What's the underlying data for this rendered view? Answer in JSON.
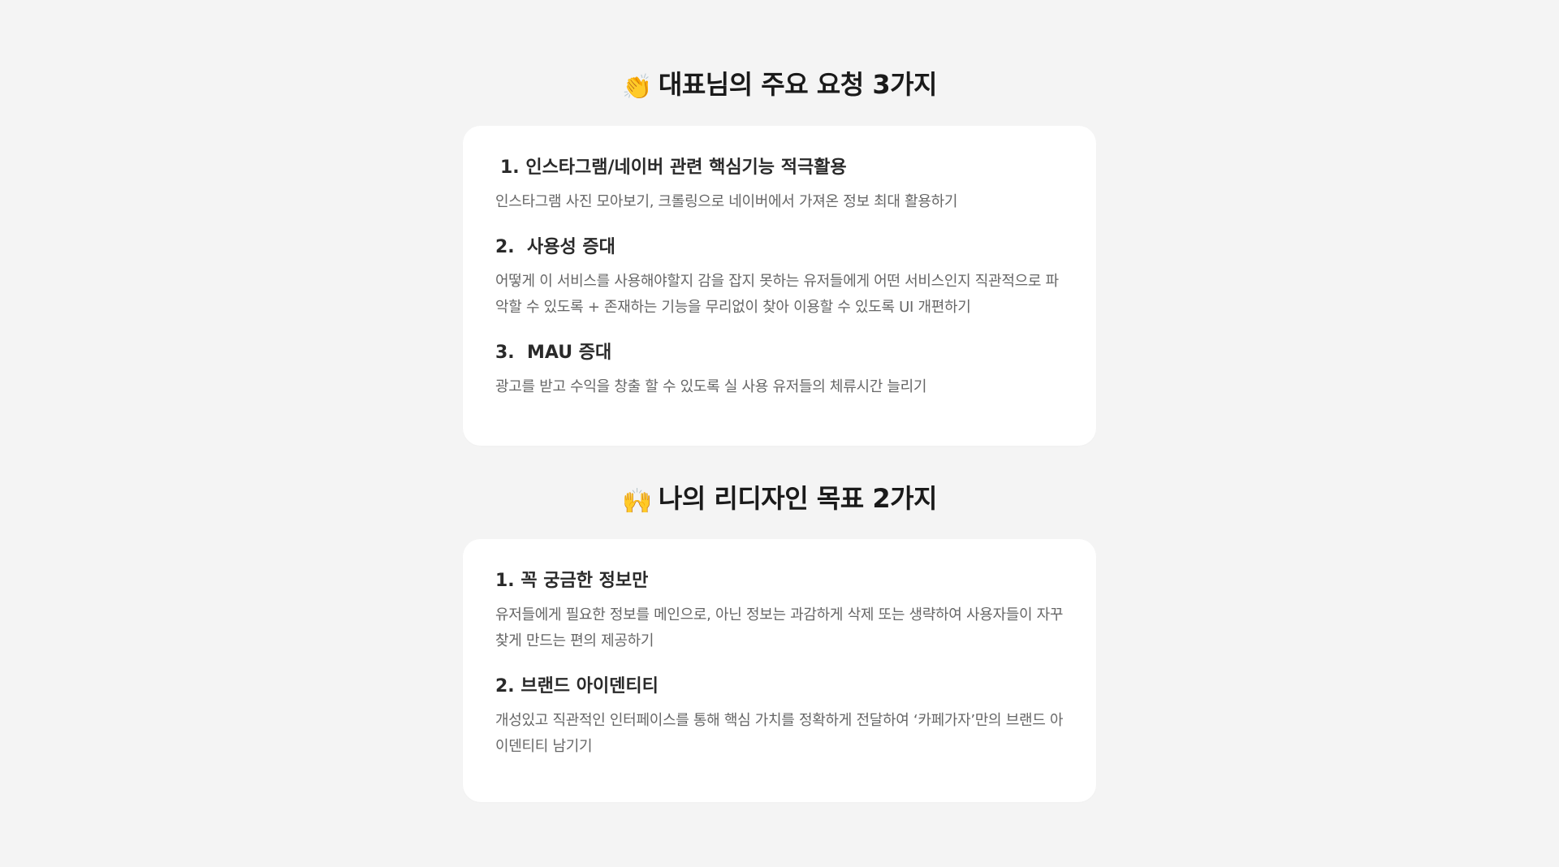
{
  "section1": {
    "emoji": "👏",
    "title": "대표님의 주요 요청 3가지",
    "items": [
      {
        "heading": "1. 인스타그램/네이버 관련 핵심기능 적극활용",
        "body": "인스타그램 사진 모아보기, 크롤링으로 네이버에서 가져온 정보 최대 활용하기"
      },
      {
        "heading": "2.  사용성 증대",
        "body": "어떻게 이 서비스를 사용해야할지 감을 잡지 못하는 유저들에게 어떤 서비스인지 직관적으로 파악할 수 있도록 + 존재하는 기능을 무리없이 찾아 이용할 수 있도록 UI 개편하기"
      },
      {
        "heading": "3.  MAU 증대",
        "body": "광고를 받고 수익을 창출 할 수 있도록 실 사용 유저들의 체류시간 늘리기"
      }
    ]
  },
  "section2": {
    "emoji": "🙌",
    "title": "나의 리디자인 목표 2가지",
    "items": [
      {
        "heading": "1. 꼭 궁금한 정보만",
        "body": "유저들에게 필요한 정보를 메인으로, 아닌 정보는 과감하게 삭제 또는 생략하여 사용자들이 자꾸 찾게 만드는 편의 제공하기"
      },
      {
        "heading": "2. 브랜드 아이덴티티",
        "body": "개성있고 직관적인 인터페이스를 통해 핵심 가치를 정확하게 전달하여 ‘카페가자’만의 브랜드 아이덴티티 남기기"
      }
    ]
  }
}
